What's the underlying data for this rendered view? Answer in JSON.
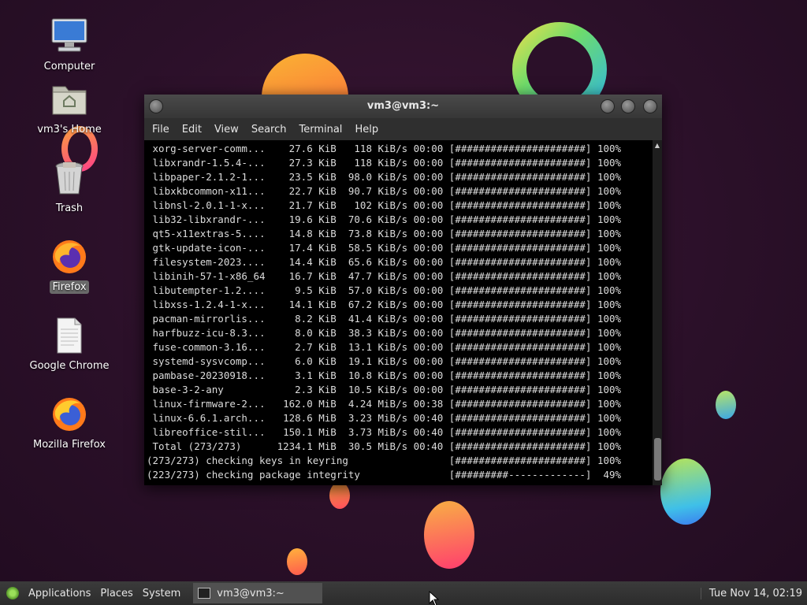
{
  "desktop": {
    "icons": [
      {
        "label": "Computer",
        "icon": "computer-icon"
      },
      {
        "label": "vm3's Home",
        "icon": "home-folder-icon"
      },
      {
        "label": "Trash",
        "icon": "trash-icon"
      },
      {
        "label": "Firefox",
        "icon": "firefox-icon"
      },
      {
        "label": "Google Chrome",
        "icon": "document-icon"
      },
      {
        "label": "Mozilla Firefox",
        "icon": "firefox-icon"
      }
    ]
  },
  "terminal": {
    "title": "vm3@vm3:~",
    "menu": [
      "File",
      "Edit",
      "View",
      "Search",
      "Terminal",
      "Help"
    ],
    "lines": [
      " xorg-server-comm...    27.6 KiB   118 KiB/s 00:00 [######################] 100%",
      " libxrandr-1.5.4-...    27.3 KiB   118 KiB/s 00:00 [######################] 100%",
      " libpaper-2.1.2-1...    23.5 KiB  98.0 KiB/s 00:00 [######################] 100%",
      " libxkbcommon-x11...    22.7 KiB  90.7 KiB/s 00:00 [######################] 100%",
      " libnsl-2.0.1-1-x...    21.7 KiB   102 KiB/s 00:00 [######################] 100%",
      " lib32-libxrandr-...    19.6 KiB  70.6 KiB/s 00:00 [######################] 100%",
      " qt5-x11extras-5....    14.8 KiB  73.8 KiB/s 00:00 [######################] 100%",
      " gtk-update-icon-...    17.4 KiB  58.5 KiB/s 00:00 [######################] 100%",
      " filesystem-2023....    14.4 KiB  65.6 KiB/s 00:00 [######################] 100%",
      " libinih-57-1-x86_64    16.7 KiB  47.7 KiB/s 00:00 [######################] 100%",
      " libutempter-1.2....     9.5 KiB  57.0 KiB/s 00:00 [######################] 100%",
      " libxss-1.2.4-1-x...    14.1 KiB  67.2 KiB/s 00:00 [######################] 100%",
      " pacman-mirrorlis...     8.2 KiB  41.4 KiB/s 00:00 [######################] 100%",
      " harfbuzz-icu-8.3...     8.0 KiB  38.3 KiB/s 00:00 [######################] 100%",
      " fuse-common-3.16...     2.7 KiB  13.1 KiB/s 00:00 [######################] 100%",
      " systemd-sysvcomp...     6.0 KiB  19.1 KiB/s 00:00 [######################] 100%",
      " pambase-20230918...     3.1 KiB  10.8 KiB/s 00:00 [######################] 100%",
      " base-3-2-any            2.3 KiB  10.5 KiB/s 00:00 [######################] 100%",
      " linux-firmware-2...   162.0 MiB  4.24 MiB/s 00:38 [######################] 100%",
      " linux-6.6.1.arch...   128.6 MiB  3.23 MiB/s 00:40 [######################] 100%",
      " libreoffice-stil...   150.1 MiB  3.73 MiB/s 00:40 [######################] 100%",
      " Total (273/273)      1234.1 MiB  30.5 MiB/s 00:40 [######################] 100%",
      "(273/273) checking keys in keyring                 [######################] 100%",
      "(223/273) checking package integrity               [#########-------------]  49%"
    ]
  },
  "taskbar": {
    "menus": [
      "Applications",
      "Places",
      "System"
    ],
    "task_label": "vm3@vm3:~",
    "clock": "Tue Nov 14, 02:19"
  }
}
